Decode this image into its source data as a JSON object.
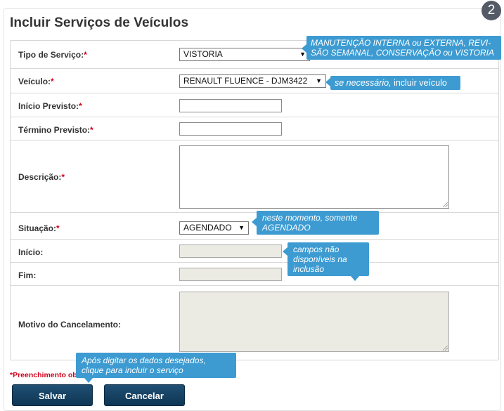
{
  "step_badge": "2",
  "title": "Incluir Serviços de Veículos",
  "fields": {
    "tipo_servico": {
      "label": "Tipo de Serviço:",
      "required_mark": "*",
      "selected": "VISTORIA"
    },
    "veiculo": {
      "label": "Veículo:",
      "required_mark": "*",
      "selected": "RENAULT FLUENCE - DJM3422"
    },
    "inicio_previsto": {
      "label": "Início Previsto:",
      "required_mark": "*",
      "value": ""
    },
    "termino_previsto": {
      "label": "Término Previsto:",
      "required_mark": "*",
      "value": ""
    },
    "descricao": {
      "label": "Descrição:",
      "required_mark": "*",
      "value": ""
    },
    "situacao": {
      "label": "Situação:",
      "required_mark": "*",
      "selected": "AGENDADO"
    },
    "inicio": {
      "label": "Início:",
      "value": ""
    },
    "fim": {
      "label": "Fim:",
      "value": ""
    },
    "motivo_cancelamento": {
      "label": "Motivo do Cancelamento:",
      "value": ""
    }
  },
  "required_note": "*Preenchimento ob",
  "buttons": {
    "save": "Salvar",
    "cancel": "Cancelar"
  },
  "tooltips": {
    "tipo_servico_line1": "MANUTENÇÃO INTERNA ou EXTERNA, REVI-",
    "tipo_servico_line2": "SÃO SEMANAL, CONSERVAÇÃO ou VISTORIA",
    "veiculo_em": "se necessário,",
    "veiculo_rest": " incluir veículo",
    "situacao_line1": "neste momento, somente",
    "situacao_line2": "AGENDADO",
    "campos_line1": "campos não",
    "campos_line2": "disponíveis na",
    "campos_line3": "inclusão",
    "salvar_line1": "Após digitar os dados desejados,",
    "salvar_line2": "clique para incluir o serviço"
  },
  "colors": {
    "accent": "#3d9bd1",
    "button": "#143f60",
    "required": "#d0021b",
    "badge": "#555b66"
  }
}
